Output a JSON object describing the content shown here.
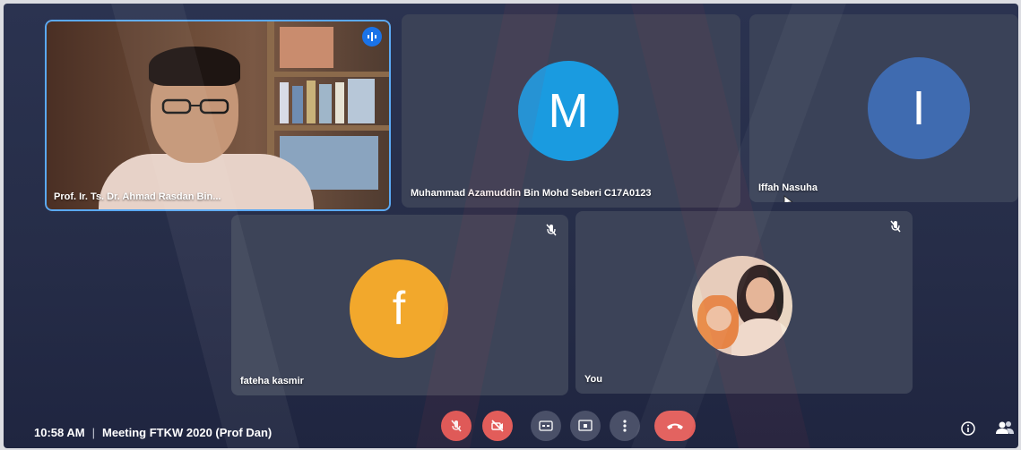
{
  "meeting": {
    "time": "10:58 AM",
    "separator": "|",
    "title": "Meeting FTKW 2020 (Prof Dan)"
  },
  "participants": [
    {
      "name": "Prof. Ir. Ts. Dr. Ahmad Rasdan Bin...",
      "type": "video",
      "speaking": true
    },
    {
      "name": "Muhammad Azamuddin Bin Mohd Seberi C17A0123",
      "initial": "M",
      "avatar_color": "#1a9be0"
    },
    {
      "name": "Iffah Nasuha",
      "initial": "I",
      "avatar_color": "#3f6bb0"
    },
    {
      "name": "fateha kasmir",
      "initial": "f",
      "avatar_color": "#f2a82c",
      "muted": true
    },
    {
      "name": "You",
      "type": "photo",
      "muted": true
    }
  ],
  "controls": [
    {
      "name": "microphone-off"
    },
    {
      "name": "camera-off"
    },
    {
      "name": "captions"
    },
    {
      "name": "present-now"
    },
    {
      "name": "more-options"
    },
    {
      "name": "end-call"
    }
  ],
  "side_icons": [
    "info-icon",
    "people-icon"
  ],
  "colors": {
    "background": "#262d48",
    "accent": "#1a73e8",
    "danger": "#e25d5a"
  }
}
